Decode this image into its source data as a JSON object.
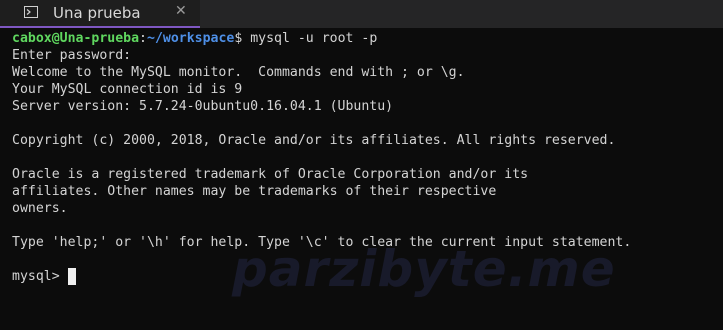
{
  "tab": {
    "title": "Una prueba",
    "close_glyph": "✕",
    "icon": "terminal-icon"
  },
  "terminal": {
    "prompt": {
      "user_host": "cabox@Una-prueba",
      "sep": ":",
      "path": "~/workspace",
      "dollar": "$ ",
      "command": "mysql -u root -p"
    },
    "lines": [
      "Enter password:",
      "Welcome to the MySQL monitor.  Commands end with ; or \\g.",
      "Your MySQL connection id is 9",
      "Server version: 5.7.24-0ubuntu0.16.04.1 (Ubuntu)",
      "",
      "Copyright (c) 2000, 2018, Oracle and/or its affiliates. All rights reserved.",
      "",
      "Oracle is a registered trademark of Oracle Corporation and/or its",
      "affiliates. Other names may be trademarks of their respective",
      "owners.",
      "",
      "Type 'help;' or '\\h' for help. Type '\\c' to clear the current input statement.",
      ""
    ],
    "mysql_prompt": "mysql> "
  },
  "watermark": "parzibyte.me",
  "colors": {
    "background": "#0c0c0c",
    "text": "#d4d4d4",
    "user_host": "#5fd75f",
    "path": "#4e8fe6",
    "tab_accent": "#7e57c2"
  }
}
